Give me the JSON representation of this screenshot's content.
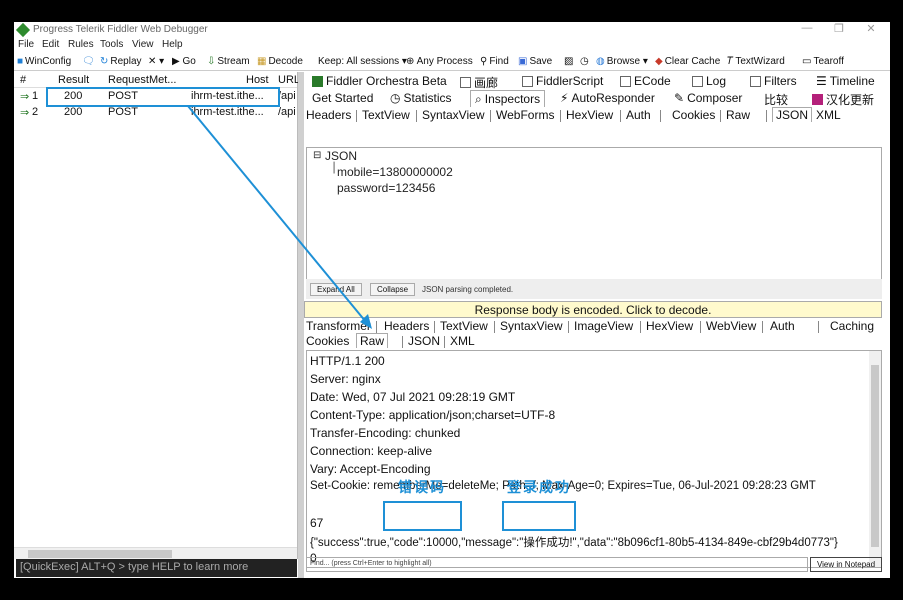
{
  "window": {
    "title": "Progress Telerik Fiddler Web Debugger",
    "controls": [
      "—",
      "❐",
      "✕"
    ]
  },
  "menu": [
    "File",
    "Edit",
    "Rules",
    "Tools",
    "View",
    "Help"
  ],
  "toolbar": {
    "winconfig": "WinConfig",
    "replay": "Replay",
    "remove": "✕ ▾",
    "go": "▶ Go",
    "stream": "Stream",
    "decode": "Decode",
    "keep": "Keep: All sessions ▾",
    "process": "⊕ Any Process",
    "find": "Find",
    "save": "Save",
    "browse": "Browse ▾",
    "clear_cache": "Clear Cache",
    "textwizard": "TextWizard",
    "tearoff": "Tearoff"
  },
  "sessions": {
    "columns": [
      "#",
      "Result",
      "RequestMet...",
      "Host",
      "URL"
    ],
    "rows": [
      {
        "id": "1",
        "result": "200",
        "method": "POST",
        "host": "ihrm-test.ithe...",
        "url": "/api"
      },
      {
        "id": "2",
        "result": "200",
        "method": "POST",
        "host": "ihrm-test.ithe...",
        "url": "/api"
      }
    ]
  },
  "quickexec": "[QuickExec] ALT+Q > type HELP to learn more",
  "top_tabs": [
    "Fiddler Orchestra Beta",
    "画廊",
    "FiddlerScript",
    "ECode",
    "Log",
    "Filters",
    "Timeline"
  ],
  "second_tabs": [
    "Get Started",
    "Statistics",
    "Inspectors",
    "AutoResponder",
    "Composer",
    "比较",
    "汉化更新"
  ],
  "request_tabs": [
    "Headers",
    "TextView",
    "SyntaxView",
    "WebForms",
    "HexView",
    "Auth",
    "Cookies",
    "Raw",
    "JSON",
    "XML"
  ],
  "json_tree": {
    "root": "JSON",
    "items": [
      "mobile=13800000002",
      "password=123456"
    ]
  },
  "json_controls": {
    "expand": "Expand All",
    "collapse": "Collapse",
    "status": "JSON parsing completed."
  },
  "response_banner": "Response body is encoded. Click to decode.",
  "response_tabs_1": [
    "Transformer",
    "Headers",
    "TextView",
    "SyntaxView",
    "ImageView",
    "HexView",
    "WebView",
    "Auth",
    "Caching"
  ],
  "response_tabs_2": [
    "Cookies",
    "Raw",
    "JSON",
    "XML"
  ],
  "raw_lines": [
    "HTTP/1.1 200",
    "Server: nginx",
    "Date: Wed, 07 Jul 2021 09:28:19 GMT",
    "Content-Type: application/json;charset=UTF-8",
    "Transfer-Encoding: chunked",
    "Connection: keep-alive",
    "Vary: Accept-Encoding",
    "Set-Cookie: rememberMe=deleteMe; Path=/; Max-Age=0; Expires=Tue, 06-Jul-2021 09:28:23 GMT",
    "",
    "67",
    "{\"success\":true,\"code\":10000,\"message\":\"操作成功!\",\"data\":\"8b096cf1-80b5-4134-849e-cbf29b4d0773\"}",
    "0"
  ],
  "annotations": {
    "error_code": "错误码",
    "login_success": "登录成功"
  },
  "find": {
    "placeholder": "Find... (press Ctrl+Enter to highlight all)",
    "notepad": "View in Notepad"
  },
  "colors": {
    "annotation": "#1e90d6",
    "banner": "#fffacd"
  }
}
